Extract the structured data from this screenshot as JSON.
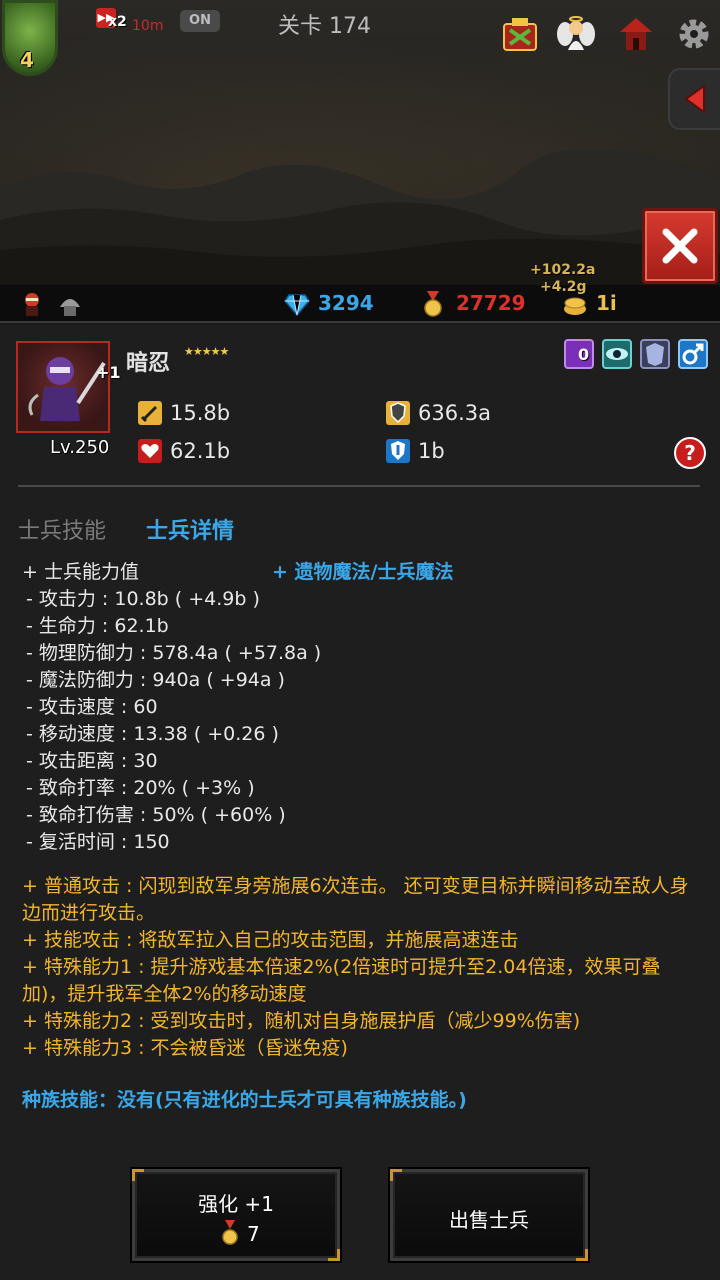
{
  "hud": {
    "hero_level": "4",
    "speed_multiplier": "x2",
    "speed_time": "10m",
    "auto_toggle": "ON",
    "stage": "关卡 174",
    "float_gold_1": "+102.2a",
    "float_gold_2": "+4.2g"
  },
  "currency": {
    "gems": "3294",
    "medals": "27729",
    "gold": "1i",
    "colors": {
      "gems": "#3aa7e8",
      "medals": "#e0302a",
      "gold": "#e8c04a"
    }
  },
  "unit": {
    "name": "暗忍",
    "stars": "★★★★★",
    "plus": "+1",
    "level": "Lv.250",
    "attack": "15.8b",
    "phys_defense": "636.3a",
    "hp": "62.1b",
    "magic_defense": "1b",
    "magic_badge_count": "0"
  },
  "tabs": {
    "skills": "士兵技能",
    "details": "士兵详情"
  },
  "details": {
    "stats_title": "+ 士兵能力值",
    "relic_magic": "+ 遗物魔法/士兵魔法",
    "lines": [
      "- 攻击力 : 10.8b ( +4.9b )",
      "- 生命力 : 62.1b",
      "- 物理防御力 : 578.4a ( +57.8a )",
      "- 魔法防御力 : 940a ( +94a )",
      "- 攻击速度 : 60",
      "- 移动速度 : 13.38 ( +0.26 )",
      "- 攻击距离 : 30",
      "- 致命打率 : 20% ( +3% )",
      "- 致命打伤害 : 50% ( +60% )",
      "- 复活时间 : 150"
    ],
    "abilities": [
      "+ 普通攻击 : 闪现到敌军身旁施展6次连击。 还可变更目标并瞬间移动至敌人身边而进行攻击。",
      "+ 技能攻击 : 将敌军拉入自己的攻击范围，并施展高速连击",
      "+ 特殊能力1 : 提升游戏基本倍速2%(2倍速时可提升至2.04倍速，效果可叠加)，提升我军全体2%的移动速度",
      "+ 特殊能力2 : 受到攻击时，随机对自身施展护盾（减少99%伤害)",
      "+ 特殊能力3 : 不会被昏迷（昏迷免疫)"
    ],
    "race_skill": "种族技能：没有(只有进化的士兵才可具有种族技能。)"
  },
  "buttons": {
    "upgrade_label": "强化 +1",
    "upgrade_cost": "7",
    "sell_label": "出售士兵"
  },
  "icons": [
    "hero-portrait",
    "fast-forward-icon",
    "shop-chest-icon",
    "angel-icon",
    "tower-icon",
    "gear-icon",
    "back-arrow-icon",
    "close-icon",
    "diamond-icon",
    "medal-icon",
    "gold-coin-icon",
    "sword-icon",
    "shield-icon",
    "heart-icon",
    "magic-shield-icon",
    "help-icon"
  ]
}
